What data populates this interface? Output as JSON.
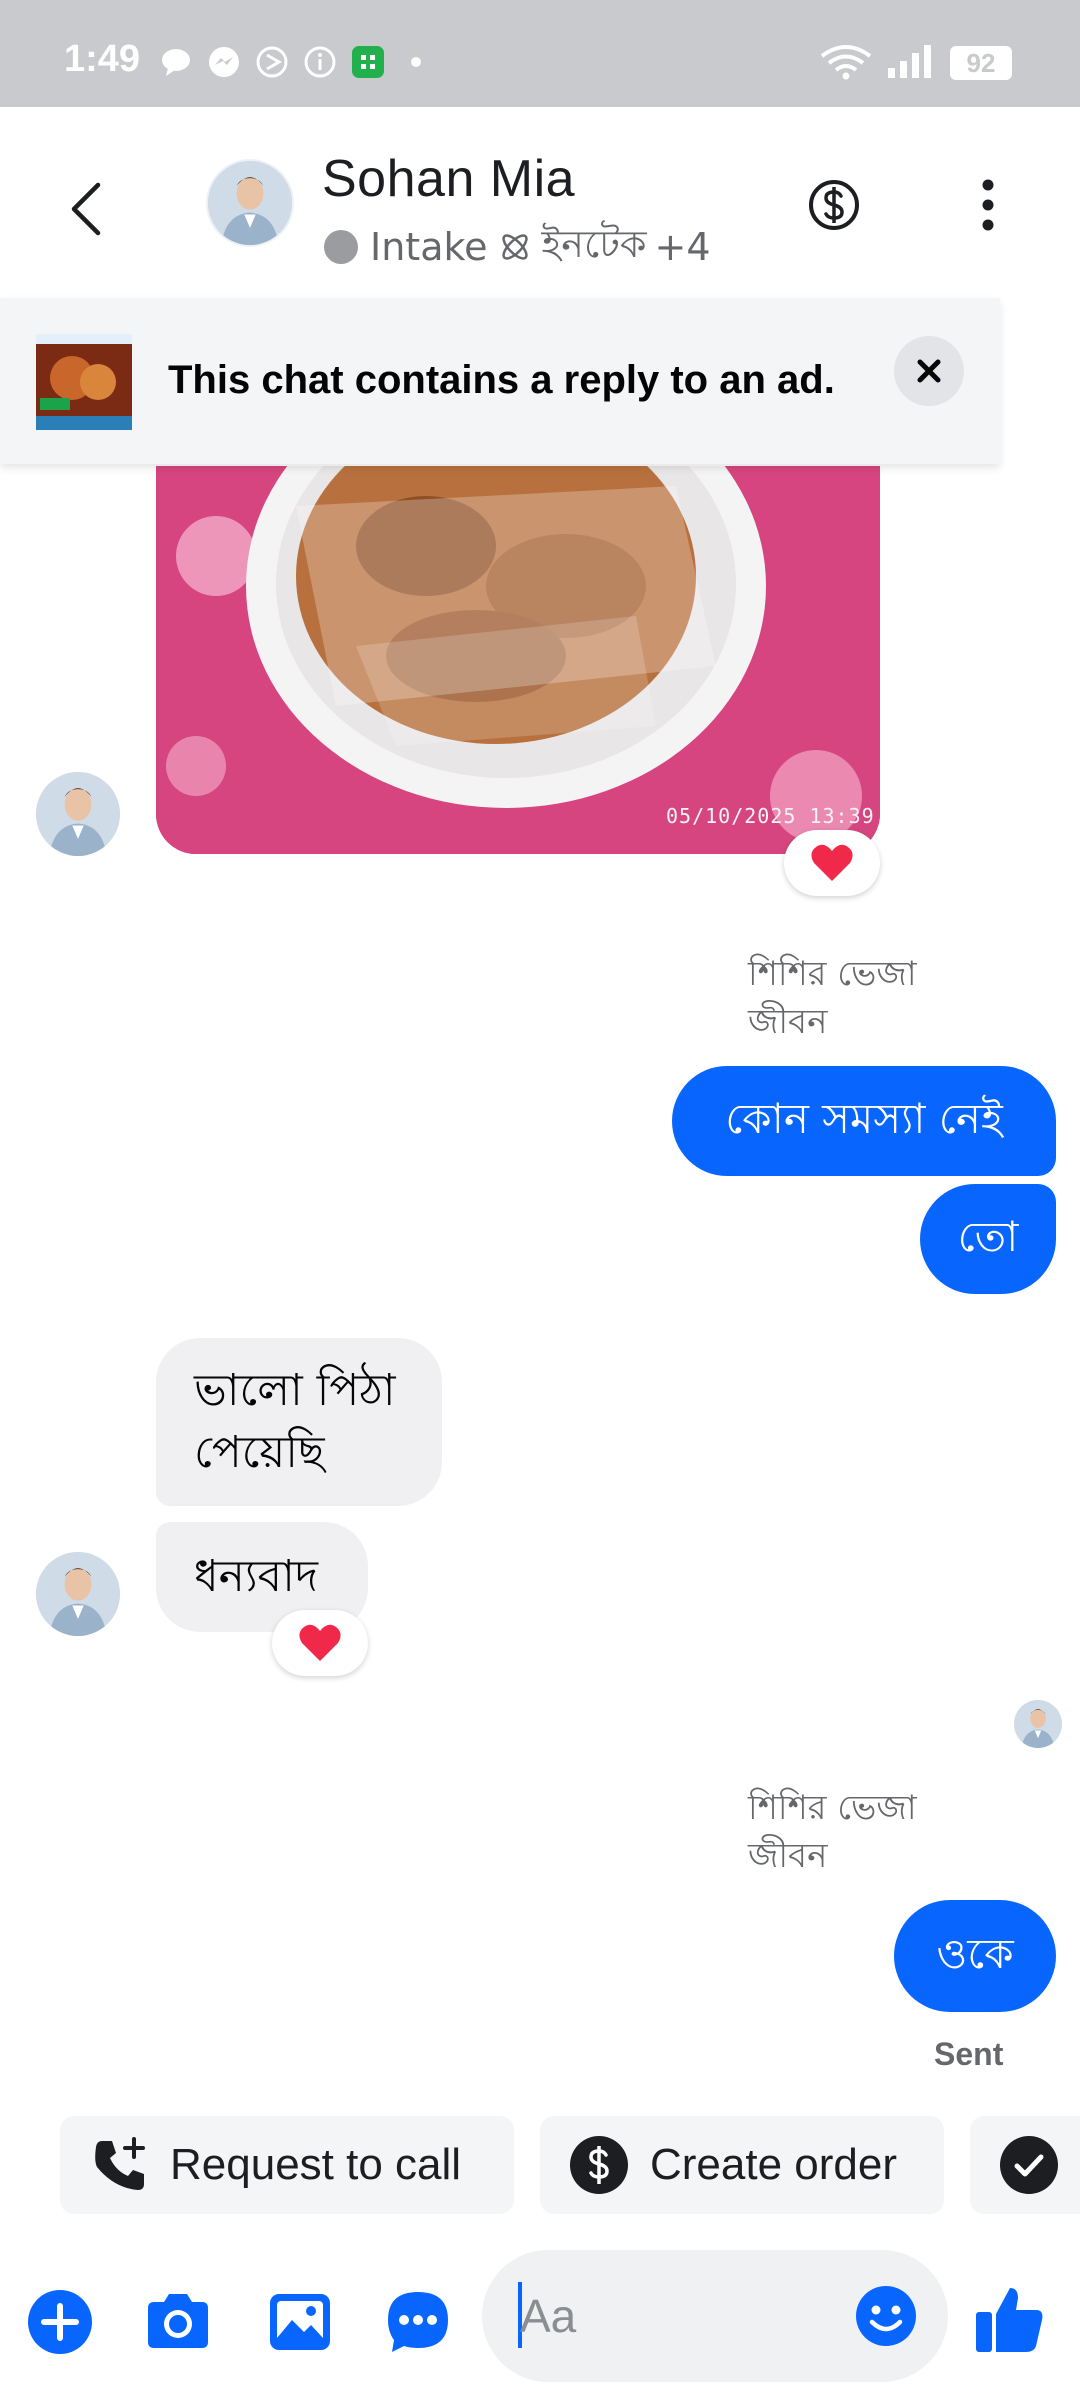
{
  "status_bar": {
    "time": "1:49",
    "battery": "92",
    "icons": [
      "chat-bubble-icon",
      "messenger-icon",
      "no-sign-icon",
      "info-icon",
      "app-icon",
      "dot-icon",
      "wifi-icon",
      "signal-icon",
      "battery-icon"
    ]
  },
  "header": {
    "name": "Sohan Mia",
    "subtitle_label": "Intake",
    "subtitle_tag": "ইনটেক",
    "subtitle_more": "+4",
    "icons": [
      "back-icon",
      "dollar-icon",
      "more-vertical-icon"
    ]
  },
  "ad_banner": {
    "text": "This chat contains a reply to an ad."
  },
  "messages": {
    "photo_timestamp": "05/10/2025  13:39",
    "sender_1": [
      "শিশির ভেজা",
      "জীবন"
    ],
    "out_1": "কোন সমস্যা নেই",
    "out_2": "তো",
    "in_1": [
      "ভালো পিঠা",
      "পেয়েছি"
    ],
    "in_2": "ধন্যবাদ",
    "sender_2": [
      "শিশির ভেজা",
      "জীবন"
    ],
    "out_3": "ওকে",
    "sent": "Sent"
  },
  "quick_actions": {
    "request_call": "Request to call",
    "create_order": "Create order"
  },
  "composer": {
    "placeholder": "Aa"
  },
  "colors": {
    "accent": "#0866ff",
    "bubble_in": "#f0f0f2",
    "status_bar": "#c8cacd",
    "heart": "#f02849"
  }
}
